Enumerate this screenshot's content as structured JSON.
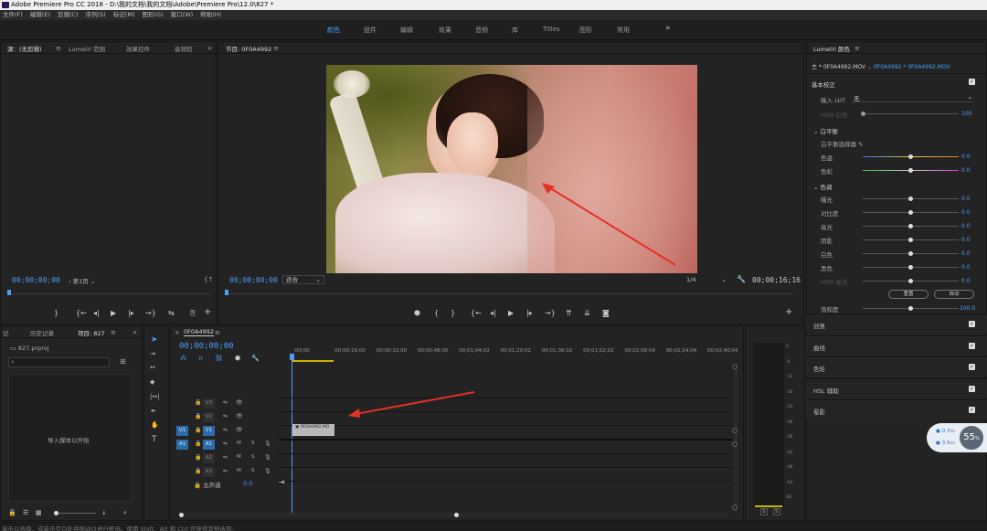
{
  "window": {
    "title": "Adobe Premiere Pro CC 2018 - D:\\我的文档\\我的文档\\Adobe\\Premiere Pro\\12.0\\827 *"
  },
  "menu": [
    "文件(F)",
    "编辑(E)",
    "剪辑(C)",
    "序列(S)",
    "标记(M)",
    "图形(G)",
    "窗口(W)",
    "帮助(H)"
  ],
  "workspaces": [
    "颜色",
    "组件",
    "编辑",
    "效果",
    "音频",
    "库",
    "Titles",
    "图形",
    "常用"
  ],
  "source_panel": {
    "tabs": [
      "源：(无剪辑)",
      "Lumetri 范围",
      "效果控件",
      "音频剪"
    ],
    "timecode": "00;00;00;00",
    "page": "第1页"
  },
  "program_panel": {
    "title": "节目: 0F0A4992",
    "timecode_left": "00;00;00;00",
    "fit": "适合",
    "ratio": "1/4",
    "timecode_right": "00;00;16;16"
  },
  "project_panel": {
    "tabs": [
      "记",
      "历史记录",
      "项目: 827"
    ],
    "file": "827.prproj",
    "import_hint": "导入媒体以开始"
  },
  "timeline": {
    "sequence": "0F0A4992",
    "timecode": "00;00;00;00",
    "ruler": [
      ":00;00",
      "00;00;16;00",
      "00;00;32;00",
      "00;00;48;00",
      "00;01;04;02",
      "00;01;20;02",
      "00;01;36;02",
      "00;01;52;02",
      "00;02;08;04",
      "00;02;24;04",
      "00;02;40;04"
    ],
    "tracks": [
      {
        "id": "V3",
        "kind": "video",
        "src": ""
      },
      {
        "id": "V2",
        "kind": "video",
        "src": ""
      },
      {
        "id": "V1",
        "kind": "video",
        "src": "V1"
      },
      {
        "id": "A1",
        "kind": "audio",
        "src": "A1"
      },
      {
        "id": "A2",
        "kind": "audio",
        "src": ""
      },
      {
        "id": "A3",
        "kind": "audio",
        "src": ""
      }
    ],
    "master_label": "主声道",
    "master_value": "0.0",
    "clip_name": "0F0A4992.MO",
    "audio_m": "M",
    "audio_s": "S"
  },
  "meter": {
    "ticks": [
      "0",
      "-6",
      "-12",
      "-18",
      "-24",
      "-30",
      "-36",
      "-42",
      "-48",
      "-54",
      "dB"
    ],
    "s_left": "S",
    "s_right": "S"
  },
  "lumetri": {
    "title": "Lumetri 颜色",
    "clip": "主 * 0F0A4992.MOV",
    "clip_link": "0F0A4992 * 0F0A4992.MOV",
    "basic": "基本校正",
    "lut_label": "输入 LUT",
    "lut_value": "无",
    "hdr_white": "HDR 白色",
    "hdr_white_value": "100",
    "white_balance": "白平衡",
    "wb_picker": "白平衡选择器",
    "temp": "色温",
    "temp_value": "0.0",
    "tint": "色彩",
    "tint_value": "0.0",
    "tone": "色调",
    "tone_rows": [
      {
        "label": "曝光",
        "value": "0.0"
      },
      {
        "label": "对比度",
        "value": "0.0"
      },
      {
        "label": "高光",
        "value": "0.0"
      },
      {
        "label": "阴影",
        "value": "0.0"
      },
      {
        "label": "白色",
        "value": "0.0"
      },
      {
        "label": "黑色",
        "value": "0.0"
      },
      {
        "label": "HDR 高光",
        "value": "0.0"
      }
    ],
    "reset": "重置",
    "auto": "自动",
    "saturation": "饱和度",
    "saturation_value": "100.0",
    "sections": [
      "创意",
      "曲线",
      "色轮",
      "HSL 辅助",
      "晕影"
    ]
  },
  "network": {
    "up": "0.7",
    "up_unit": "K/s",
    "down": "3.5",
    "down_unit": "K/s",
    "percent": "55",
    "percent_unit": "%"
  },
  "status": {
    "text": "单击以选择，或单击空白处并拖动以进行框选。使用 Shift、Alt 和 Ctrl 可获得其他选项。"
  },
  "colors": {
    "accent": "#4a9ff5",
    "track_on": "#2d6ca8",
    "arrow": "#e53027",
    "clip": "#b8b8b8"
  }
}
